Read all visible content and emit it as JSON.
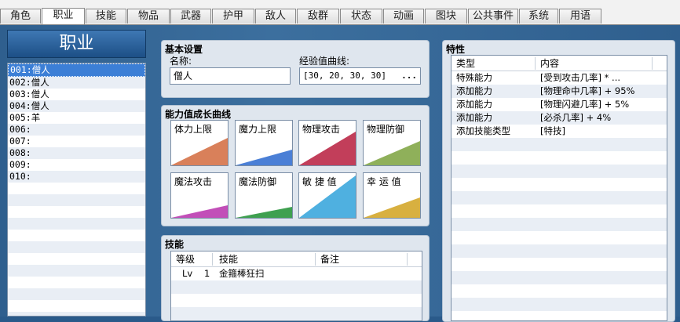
{
  "tabs": [
    {
      "label": "角色"
    },
    {
      "label": "职业"
    },
    {
      "label": "技能"
    },
    {
      "label": "物品"
    },
    {
      "label": "武器"
    },
    {
      "label": "护甲"
    },
    {
      "label": "敌人"
    },
    {
      "label": "敌群"
    },
    {
      "label": "状态"
    },
    {
      "label": "动画"
    },
    {
      "label": "图块"
    },
    {
      "label": "公共事件"
    },
    {
      "label": "系统"
    },
    {
      "label": "用语"
    }
  ],
  "active_tab": "职业",
  "left": {
    "title": "职业",
    "items": [
      {
        "label": "001:僧人"
      },
      {
        "label": "002:僧人"
      },
      {
        "label": "003:僧人"
      },
      {
        "label": "004:僧人"
      },
      {
        "label": "005:羊"
      },
      {
        "label": "006:"
      },
      {
        "label": "007:"
      },
      {
        "label": "008:"
      },
      {
        "label": "009:"
      },
      {
        "label": "010:"
      }
    ]
  },
  "basic": {
    "title": "基本设置",
    "name_label": "名称:",
    "name_value": "僧人",
    "exp_label": "经验值曲线:",
    "exp_value": "[30, 20, 30, 30]",
    "exp_button": "..."
  },
  "growth": {
    "title": "能力值成长曲线",
    "curves": [
      {
        "label": "体力上限",
        "color": "#d9805a",
        "level": 0.62
      },
      {
        "label": "魔力上限",
        "color": "#4a7fd6",
        "level": 0.35
      },
      {
        "label": "物理攻击",
        "color": "#c23e5a",
        "level": 0.75
      },
      {
        "label": "物理防御",
        "color": "#8fb05a",
        "level": 0.55
      },
      {
        "label": "魔法攻击",
        "color": "#c24fb8",
        "level": 0.28
      },
      {
        "label": "魔法防御",
        "color": "#3fa050",
        "level": 0.25
      },
      {
        "label": "敏 捷 值",
        "color": "#4fb0e0",
        "level": 0.95
      },
      {
        "label": "幸 运 值",
        "color": "#d8b040",
        "level": 0.45
      }
    ]
  },
  "skills": {
    "title": "技能",
    "headers": [
      "等级",
      "技能",
      "备注"
    ],
    "rows": [
      {
        "lv_label": "Lv",
        "lv": "1",
        "skill": "金箍棒狂扫",
        "note": ""
      }
    ]
  },
  "traits": {
    "title": "特性",
    "headers": [
      "类型",
      "内容"
    ],
    "rows": [
      {
        "type": "特殊能力",
        "content": "[受到攻击几率] * ..."
      },
      {
        "type": "添加能力",
        "content": "[物理命中几率] + 95%"
      },
      {
        "type": "添加能力",
        "content": "[物理闪避几率] + 5%"
      },
      {
        "type": "添加能力",
        "content": "[必杀几率] + 4%"
      },
      {
        "type": "添加技能类型",
        "content": "[特技]"
      }
    ]
  }
}
